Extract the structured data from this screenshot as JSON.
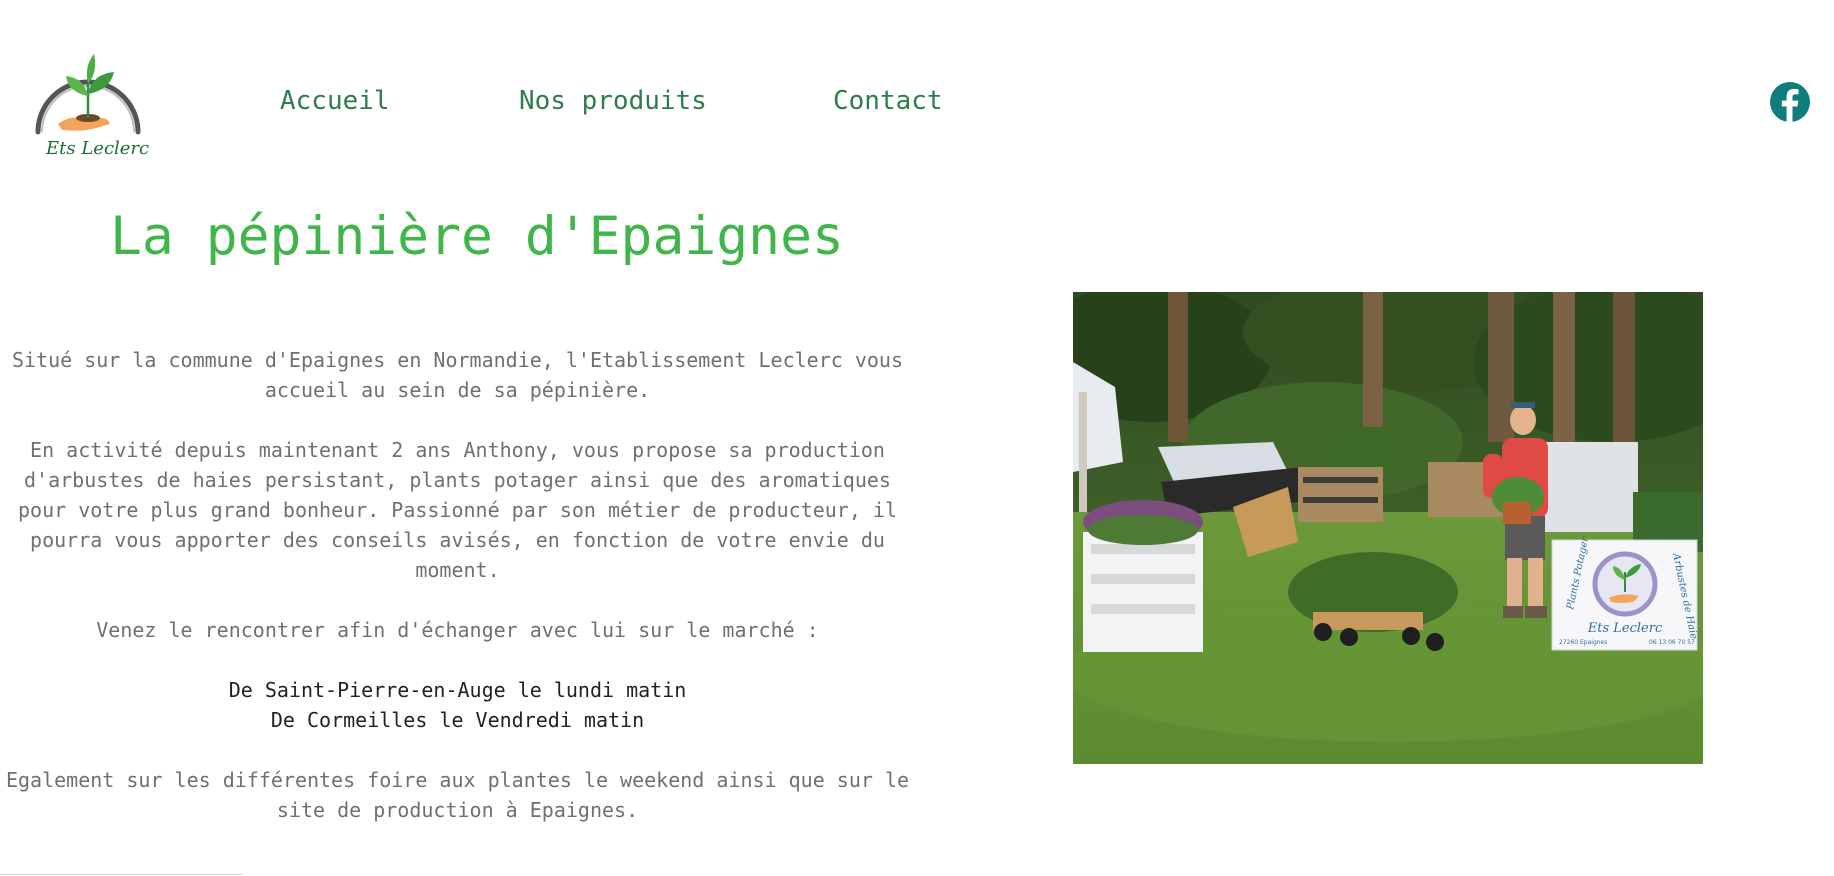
{
  "logo": {
    "text": "Ets Leclerc"
  },
  "nav": {
    "items": [
      {
        "label": "Accueil"
      },
      {
        "label": "Nos produits"
      },
      {
        "label": "Contact"
      }
    ]
  },
  "social": {
    "icon": "facebook-icon",
    "color": "#0f7d7b"
  },
  "page": {
    "title": "La pépinière d'Epaignes",
    "paragraphs": {
      "p1": "Situé sur la commune d'Epaignes en Normandie, l'Etablissement Leclerc vous accueil au sein de sa pépinière.",
      "p2": "En activité depuis maintenant 2 ans Anthony, vous propose sa production d'arbustes de haies persistant, plants potager ainsi que des aromatiques pour votre plus grand bonheur. Passionné par son métier de producteur, il pourra vous apporter des conseils avisés, en fonction de votre envie du moment.",
      "p3": "Venez le rencontrer afin d'échanger avec lui sur le marché :",
      "market1": "De Saint-Pierre-en-Auge le lundi matin",
      "market2": "De Cormeilles le Vendredi matin",
      "p4": "Egalement sur les différentes foire aux plantes le weekend ainsi que sur le site de production à Epaignes."
    }
  },
  "photo": {
    "sign": {
      "left_text": "Plants Potager",
      "right_text": "Arbustes de Haie",
      "brand": "Ets Leclerc",
      "postcode": "27260 Epaignes",
      "phone": "06 13 06 70 57"
    }
  },
  "colors": {
    "title": "#3fb54a",
    "nav": "#2e7d4b",
    "body_text": "#707070"
  }
}
